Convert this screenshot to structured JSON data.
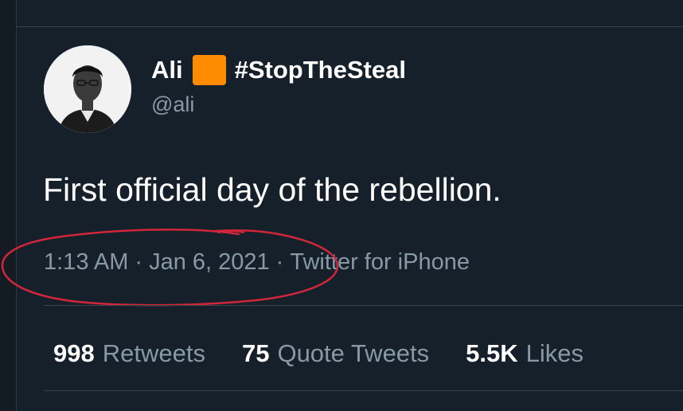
{
  "tweet": {
    "author": {
      "name": "Ali",
      "name_suffix": "#StopTheSteal",
      "handle": "@ali",
      "badge_color": "#ff8c00"
    },
    "text": "First official day of the rebellion.",
    "meta": {
      "time": "1:13 AM",
      "separator": "·",
      "date": "Jan 6, 2021",
      "source": "Twitter for iPhone"
    },
    "stats": [
      {
        "count": "998",
        "label": "Retweets"
      },
      {
        "count": "75",
        "label": "Quote Tweets"
      },
      {
        "count": "5.5K",
        "label": "Likes"
      }
    ]
  },
  "annotation": {
    "color": "#d1263a",
    "shape": "hand-drawn-circle"
  },
  "colors": {
    "background": "#15202b",
    "text": "#ffffff",
    "secondary_text": "#8899a6",
    "divider": "#38444d"
  }
}
